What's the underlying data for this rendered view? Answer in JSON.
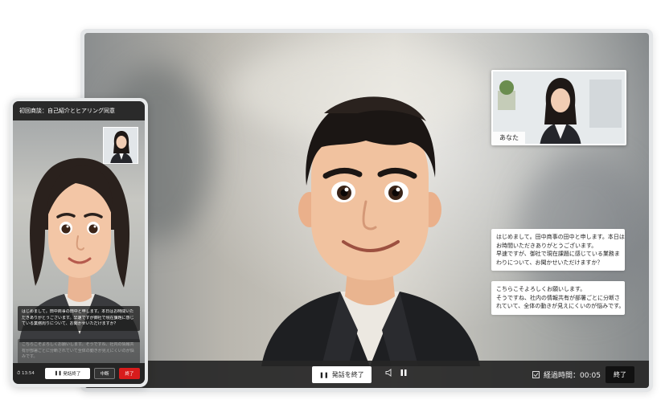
{
  "desktop": {
    "pip_label": "あなた",
    "bubble_ai": [
      "はじめまして。田中商事の田中と申します。本日は",
      "お時間いただきありがとうございます。",
      "早速ですが、御社で現在課題に感じている業務ま",
      "わりについて、お聞かせいただけますか？"
    ],
    "bubble_user": [
      "こちらこそよろしくお願いします。",
      "そうですね、社内の情報共有が部署ごとに分断さ",
      "れていて、全体の動きが見えにくいのが悩みです。"
    ],
    "toolbar": {
      "stop_label": "発話を終了",
      "elapsed_label": "経過時間：00:05",
      "end_label": "終了"
    }
  },
  "phone": {
    "header_title": "初回商談：自己紹介とヒアリング同意",
    "transcript_ai": [
      "はじめまして。田中商事の田中と申します。本日はお時間いた",
      "だきありがとうございます。早速ですが御社で現在課題に感じ",
      "ている業務周りについて、お聞かせいただけますか？"
    ],
    "transcript_user": [
      "こちらこそよろしくお願いします。そうですね、社内の情報共",
      "有が部署ごとに分断されていて全体の動きが見えにくいのが悩",
      "みです。"
    ],
    "time": "13:54",
    "btn_stop": "発話終了",
    "btn_pause": "中断",
    "btn_end": "終了"
  },
  "colors": {
    "toolbar_bg": "#262626",
    "end_red": "#d71c1c"
  }
}
